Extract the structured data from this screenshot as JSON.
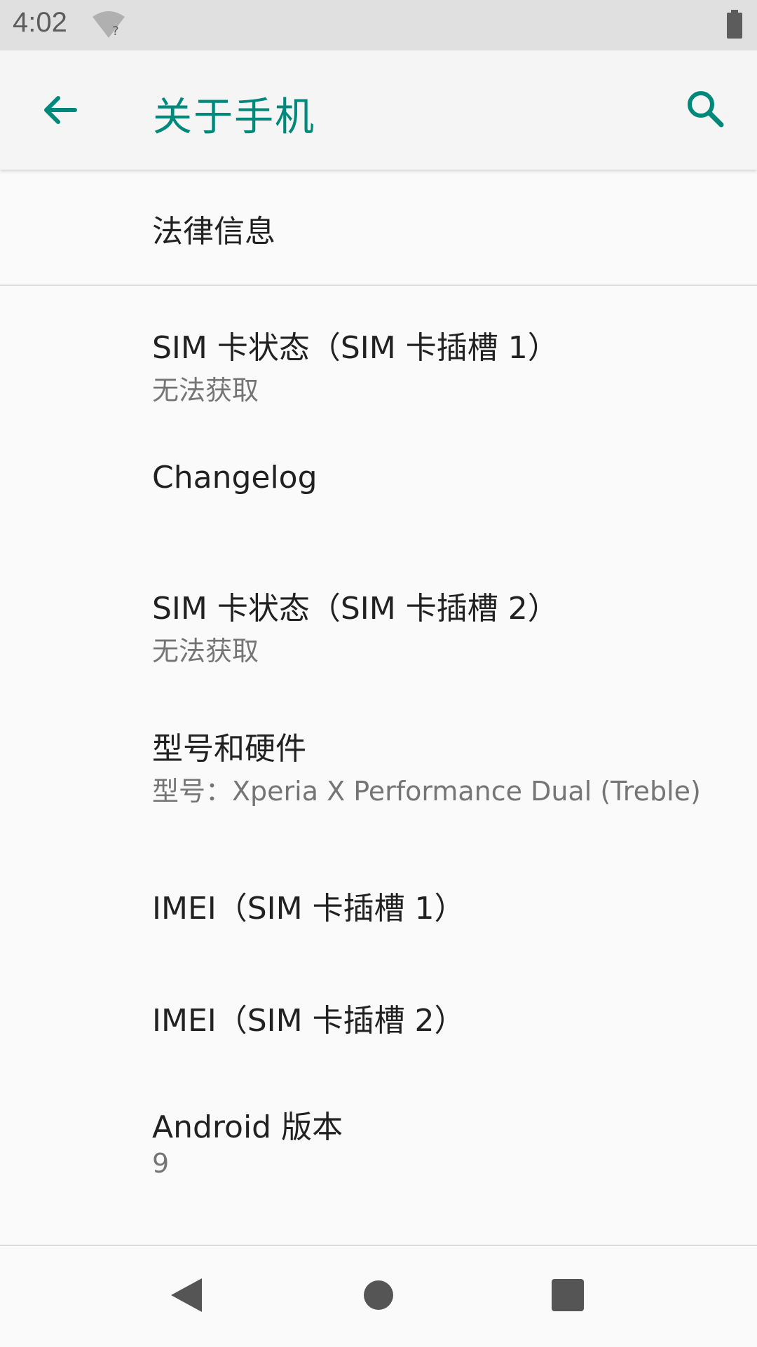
{
  "status_bar": {
    "time": "4:02",
    "wifi_icon": "wifi-unknown-icon",
    "battery_icon": "battery-icon"
  },
  "app_bar": {
    "back_icon": "arrow-back-icon",
    "title": "关于手机",
    "search_icon": "search-icon",
    "accent_color": "#00897b"
  },
  "items": [
    {
      "title": "法律信息",
      "summary": ""
    },
    {
      "title": "SIM 卡状态（SIM 卡插槽 1）",
      "summary": "无法获取"
    },
    {
      "title": "Changelog",
      "summary": ""
    },
    {
      "title": "SIM 卡状态（SIM 卡插槽 2）",
      "summary": "无法获取"
    },
    {
      "title": "型号和硬件",
      "summary": "型号：Xperia X Performance Dual (Treble)"
    },
    {
      "title": "IMEI（SIM 卡插槽 1）",
      "summary": ""
    },
    {
      "title": "IMEI（SIM 卡插槽 2）",
      "summary": ""
    },
    {
      "title": "Android 版本",
      "summary": "9"
    }
  ],
  "nav_bar": {
    "back": "nav-back-icon",
    "home": "nav-home-icon",
    "recents": "nav-recents-icon"
  }
}
